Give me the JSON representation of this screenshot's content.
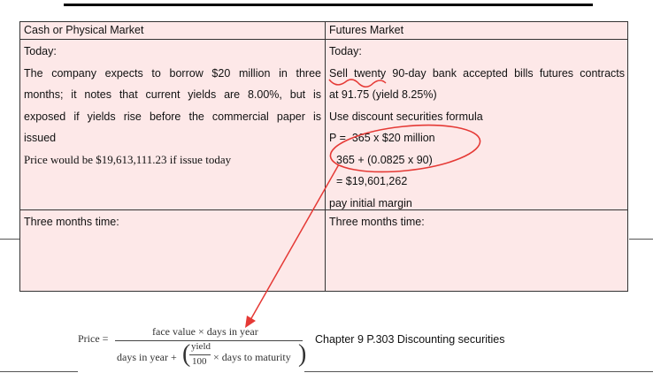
{
  "table": {
    "header_cash": "Cash or Physical Market",
    "header_futures": "Futures Market",
    "cash_today": {
      "label": "Today:",
      "lines": [
        "The company expects to borrow $20 million in three",
        "months; it notes that current yields are 8.00%, but is",
        "exposed if yields rise before the commercial paper is",
        "issued"
      ],
      "price_line": "Price would be $19,613,111.23 if issue today"
    },
    "futures_today": {
      "label": "Today:",
      "lines": [
        "Sell twenty 90-day bank accepted bills futures contracts",
        "at 91.75 (yield 8.25%)",
        "Use discount securities formula",
        "P =  365 x $20 million",
        "365 + (0.0825 x 90)",
        "= $19,601,262",
        "pay initial margin"
      ]
    },
    "cash_later": "Three months time:",
    "futures_later": "Three months time:"
  },
  "formula": {
    "lhs": "Price =",
    "numerator": "face value × days in year",
    "denom_left": "days in year +",
    "yield": "yield",
    "hundred": "100",
    "denom_right": "× days to maturity"
  },
  "caption": "Chapter 9 P.303 Discounting securities",
  "colors": {
    "table_fill": "#fde8e8",
    "annotation": "#e53935"
  }
}
